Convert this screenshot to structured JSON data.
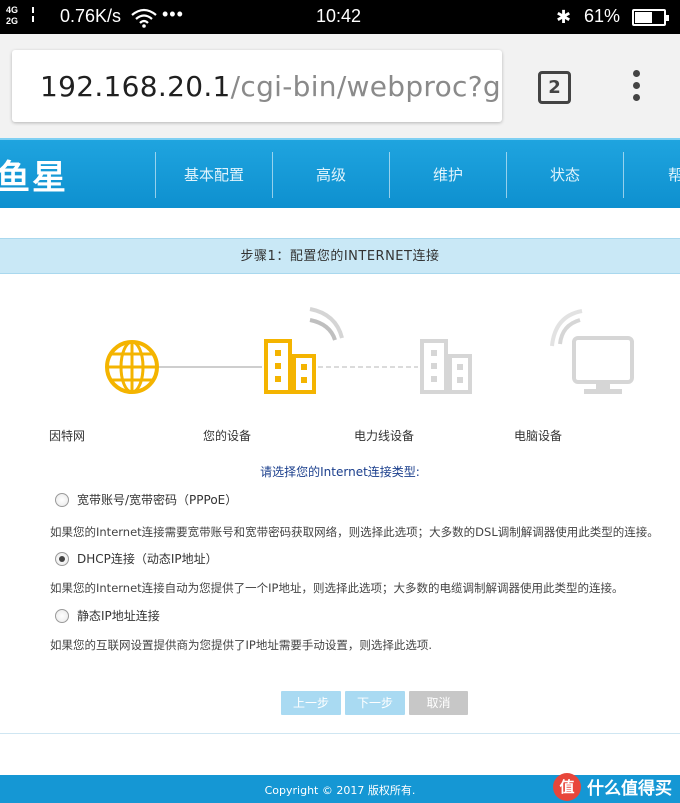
{
  "status_bar": {
    "network_top": "4G",
    "network_bottom": "2G",
    "speed": "0.76K/s",
    "more": "•••",
    "time": "10:42",
    "bluetooth": "✱",
    "battery_percent": "61%",
    "battery_level": 0.61
  },
  "browser": {
    "url_host": "192.168.20.1",
    "url_path": "/cgi-bin/webproc?getp",
    "tab_count": "2"
  },
  "router": {
    "brand": "鱼星",
    "nav": [
      "基本配置",
      "高级",
      "维护",
      "状态",
      "帮"
    ]
  },
  "wizard": {
    "step_title": "步骤1：配置您的INTERNET连接",
    "devices": [
      "因特网",
      "您的设备",
      "电力线设备",
      "电脑设备"
    ],
    "prompt": "请选择您的Internet连接类型:",
    "options": [
      {
        "label": "宽带账号/宽带密码（PPPoE）",
        "desc": "如果您的Internet连接需要宽带账号和宽带密码获取网络，则选择此选项；大多数的DSL调制解调器使用此类型的连接。",
        "selected": false
      },
      {
        "label": "DHCP连接（动态IP地址）",
        "desc": "如果您的Internet连接自动为您提供了一个IP地址，则选择此选项；大多数的电缆调制解调器使用此类型的连接。",
        "selected": true
      },
      {
        "label": "静态IP地址连接",
        "desc": "如果您的互联网设置提供商为您提供了IP地址需要手动设置，则选择此选项.",
        "selected": false
      }
    ],
    "buttons": {
      "prev": "上一步",
      "next": "下一步",
      "cancel": "取消"
    }
  },
  "footer": {
    "copyright": "Copyright © 2017 版权所有.",
    "watermark_badge": "值",
    "watermark_text": "什么值得买"
  },
  "colors": {
    "header_blue": "#1597d4",
    "icon_active": "#f4b400",
    "icon_inactive": "#d6d6d6",
    "step_bar": "#c9e8f6"
  }
}
